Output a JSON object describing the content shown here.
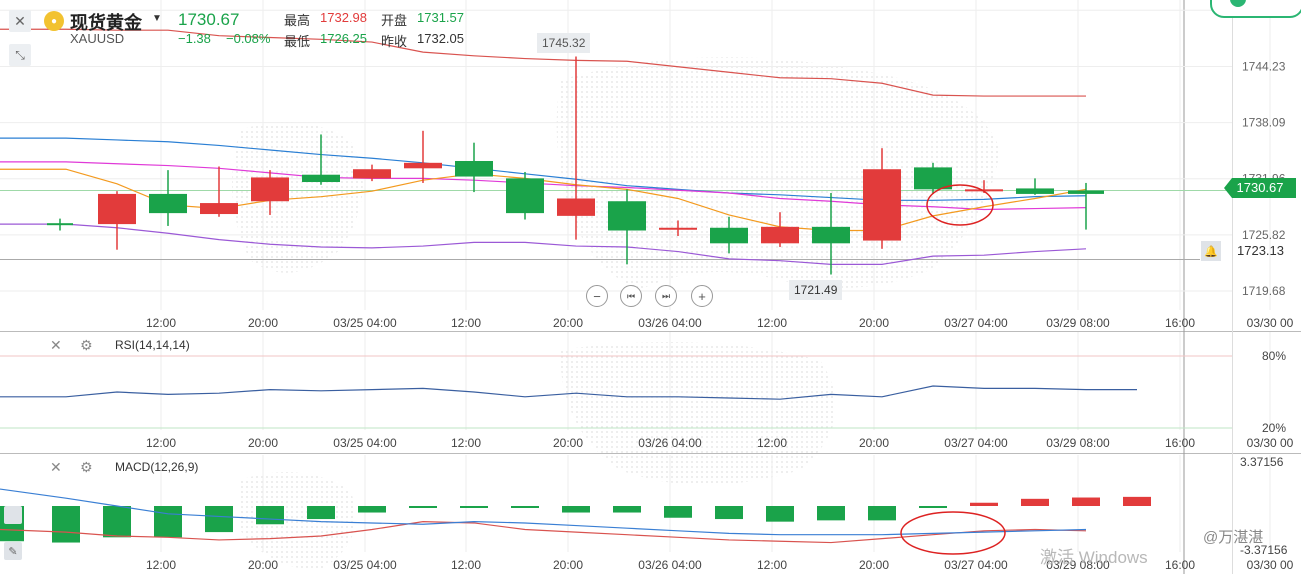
{
  "header": {
    "title": "现货黄金",
    "symbol": "XAUUSD",
    "price": "1730.67",
    "change": "−1.38",
    "change_pct": "−0.08%",
    "high_label": "最高",
    "high_value": "1732.98",
    "open_label": "开盘",
    "open_value": "1731.57",
    "low_label": "最低",
    "low_value": "1726.25",
    "prev_label": "昨收",
    "prev_value": "1732.05"
  },
  "colors": {
    "up": "#e23b3b",
    "down": "#1aa34a",
    "accent": "#e8b830"
  },
  "icons": {
    "close": "close-icon",
    "shrink": "shrink-icon",
    "coin": "coin-icon",
    "bell": "bell-icon",
    "gear": "gear-icon",
    "pencil": "pencil-icon"
  },
  "navigation": {
    "zoom_out": "−",
    "first": "⏮",
    "last": "⏭",
    "zoom_in": "+"
  },
  "watermark": {
    "windows": "激活 Windows",
    "author": "@万湛湛"
  },
  "chart_data": [
    {
      "type": "candlestick",
      "categories": [
        "c1",
        "c2",
        "c3",
        "c4",
        "c5",
        "c6",
        "c7",
        "c8",
        "c9",
        "c10",
        "c11",
        "c12",
        "c13",
        "c14",
        "c15",
        "c16",
        "c17",
        "c18",
        "c19",
        "c20",
        "c21",
        "c22"
      ],
      "candles": [
        {
          "o": 1726.9,
          "h": 1727.6,
          "l": 1726.3,
          "c": 1727.1,
          "dir": "down"
        },
        {
          "o": 1727.0,
          "h": 1730.6,
          "l": 1724.2,
          "c": 1730.3,
          "dir": "up"
        },
        {
          "o": 1730.3,
          "h": 1732.9,
          "l": 1726.8,
          "c": 1728.2,
          "dir": "down"
        },
        {
          "o": 1728.1,
          "h": 1733.3,
          "l": 1727.8,
          "c": 1729.3,
          "dir": "up"
        },
        {
          "o": 1729.5,
          "h": 1732.9,
          "l": 1728.0,
          "c": 1732.1,
          "dir": "up"
        },
        {
          "o": 1732.4,
          "h": 1736.8,
          "l": 1731.3,
          "c": 1731.6,
          "dir": "down"
        },
        {
          "o": 1732.0,
          "h": 1733.5,
          "l": 1731.7,
          "c": 1733.0,
          "dir": "up"
        },
        {
          "o": 1733.1,
          "h": 1737.2,
          "l": 1731.5,
          "c": 1733.7,
          "dir": "up"
        },
        {
          "o": 1733.9,
          "h": 1735.9,
          "l": 1730.5,
          "c": 1732.2,
          "dir": "down"
        },
        {
          "o": 1732.0,
          "h": 1732.7,
          "l": 1727.5,
          "c": 1728.2,
          "dir": "down"
        },
        {
          "o": 1727.9,
          "h": 1745.32,
          "l": 1725.3,
          "c": 1729.8,
          "dir": "up"
        },
        {
          "o": 1729.5,
          "h": 1730.8,
          "l": 1722.6,
          "c": 1726.3,
          "dir": "down"
        },
        {
          "o": 1726.5,
          "h": 1727.4,
          "l": 1725.7,
          "c": 1726.6,
          "dir": "up"
        },
        {
          "o": 1726.6,
          "h": 1727.8,
          "l": 1723.8,
          "c": 1724.9,
          "dir": "down"
        },
        {
          "o": 1724.9,
          "h": 1728.3,
          "l": 1724.5,
          "c": 1726.7,
          "dir": "up"
        },
        {
          "o": 1726.7,
          "h": 1730.4,
          "l": 1721.49,
          "c": 1724.9,
          "dir": "down"
        },
        {
          "o": 1725.2,
          "h": 1735.3,
          "l": 1724.3,
          "c": 1733.0,
          "dir": "up"
        },
        {
          "o": 1733.2,
          "h": 1733.7,
          "l": 1730.3,
          "c": 1730.8,
          "dir": "down"
        },
        {
          "o": 1730.6,
          "h": 1731.8,
          "l": 1730.4,
          "c": 1730.8,
          "dir": "up"
        },
        {
          "o": 1730.9,
          "h": 1732.0,
          "l": 1730.2,
          "c": 1730.3,
          "dir": "down"
        },
        {
          "o": 1730.3,
          "h": 1731.5,
          "l": 1726.4,
          "c": 1730.67,
          "dir": "down"
        }
      ],
      "ma_upper": [
        1748.3,
        1748.2,
        1748.2,
        1747.6,
        1747.4,
        1747.2,
        1746.9,
        1745.8,
        1745.4,
        1745.1,
        1744.9,
        1744.8,
        1744.2,
        1743.6,
        1743.0,
        1742.9,
        1742.4,
        1741.1,
        1741.0,
        1741.0,
        1741.0
      ],
      "ma_blue": [
        1736.4,
        1736.2,
        1736.0,
        1735.6,
        1735.1,
        1734.6,
        1734.2,
        1733.7,
        1733.1,
        1732.5,
        1731.9,
        1731.2,
        1730.8,
        1730.4,
        1730.2,
        1729.9,
        1729.6,
        1729.6,
        1729.7,
        1730.0,
        1730.1
      ],
      "ma_magenta": [
        1733.8,
        1733.6,
        1733.4,
        1733.1,
        1732.6,
        1732.1,
        1732.0,
        1732.0,
        1731.8,
        1731.5,
        1731.2,
        1731.0,
        1730.7,
        1730.4,
        1729.8,
        1729.5,
        1729.1,
        1728.9,
        1728.6,
        1728.7,
        1728.8
      ],
      "ma_orange": [
        1733.0,
        1731.4,
        1729.1,
        1728.7,
        1729.6,
        1730.0,
        1730.6,
        1731.8,
        1732.5,
        1732.0,
        1731.3,
        1730.8,
        1729.8,
        1728.0,
        1726.7,
        1726.3,
        1726.3,
        1727.9,
        1728.9,
        1729.8,
        1730.8
      ],
      "ma_lower": [
        1727.0,
        1726.6,
        1726.0,
        1725.3,
        1724.8,
        1724.5,
        1724.4,
        1724.6,
        1725.0,
        1725.0,
        1724.6,
        1724.5,
        1724.0,
        1723.2,
        1723.0,
        1722.6,
        1722.6,
        1723.5,
        1723.6,
        1724.0,
        1724.3
      ],
      "ylim": [
        1717.5,
        1751.5
      ],
      "y_ticks": [
        "1750.38",
        "1744.23",
        "1738.09",
        "1731.96",
        "1725.82",
        "1719.68"
      ],
      "x_ticks": [
        "12:00",
        "20:00",
        "03/25 04:00",
        "12:00",
        "20:00",
        "03/26 04:00",
        "12:00",
        "20:00",
        "03/27 04:00",
        "03/29 08:00",
        "16:00",
        "03/30 00"
      ],
      "annotations": {
        "max": "1745.32",
        "min": "1721.49"
      },
      "current_price": "1730.67",
      "alert_price": "1723.13"
    },
    {
      "type": "line",
      "title": "RSI(14,14,14)",
      "values": [
        46,
        46,
        50,
        48,
        49,
        52,
        51,
        52,
        53,
        50,
        46,
        49,
        46,
        46,
        45,
        44,
        48,
        46,
        55,
        53,
        53,
        52,
        52
      ],
      "ylim": [
        0,
        100
      ],
      "y_ticks": [
        "80%",
        "20%"
      ],
      "x_ticks": [
        "12:00",
        "20:00",
        "03/25 04:00",
        "12:00",
        "20:00",
        "03/26 04:00",
        "12:00",
        "20:00",
        "03/27 04:00",
        "03/29 08:00",
        "16:00",
        "03/30 00"
      ]
    },
    {
      "type": "bar",
      "title": "MACD(12,26,9)",
      "values": [
        -2.7,
        -2.8,
        -2.4,
        -2.4,
        -2.0,
        -1.4,
        -1.0,
        -0.5,
        -0.1,
        -0.05,
        -0.05,
        -0.5,
        -0.5,
        -0.9,
        -1.0,
        -1.2,
        -1.1,
        -1.1,
        -0.1,
        0.25,
        0.55,
        0.65,
        0.7
      ],
      "dif": [
        -1.8,
        -2.0,
        -2.3,
        -2.4,
        -2.6,
        -2.5,
        -2.3,
        -1.8,
        -1.2,
        -1.3,
        -1.8,
        -2.0,
        -2.2,
        -2.4,
        -2.6,
        -2.7,
        -2.8,
        -2.5,
        -2.2,
        -1.9,
        -1.8,
        -1.9
      ],
      "dea": [
        1.3,
        0.6,
        0.0,
        -0.6,
        -0.8,
        -1.0,
        -1.2,
        -1.3,
        -1.4,
        -1.2,
        -1.3,
        -1.5,
        -1.7,
        -1.9,
        -2.1,
        -2.2,
        -2.2,
        -2.2,
        -2.1,
        -2.0,
        -1.9,
        -1.8
      ],
      "ylim": [
        -3.37156,
        3.37156
      ],
      "y_ticks": [
        "3.37156",
        "-3.37156"
      ],
      "x_ticks": [
        "12:00",
        "20:00",
        "03/25 04:00",
        "12:00",
        "20:00",
        "03/26 04:00",
        "12:00",
        "20:00",
        "03/27 04:00",
        "03/29 08:00",
        "16:00",
        "03/30 00"
      ]
    }
  ]
}
